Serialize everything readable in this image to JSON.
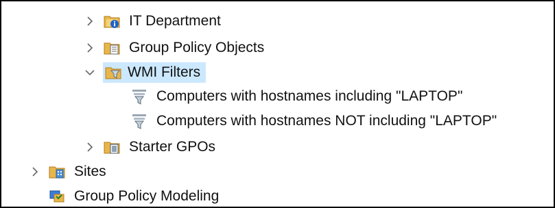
{
  "tree": {
    "items": [
      {
        "label": "IT Department",
        "icon": "ou-folder-info-icon",
        "expander": "collapsed"
      },
      {
        "label": "Group Policy Objects",
        "icon": "gpo-folder-icon",
        "expander": "collapsed"
      },
      {
        "label": "WMI Filters",
        "icon": "wmi-folder-icon",
        "expander": "expanded",
        "selected": true
      },
      {
        "label": "Computers with hostnames including \"LAPTOP\"",
        "icon": "wmi-filter-icon"
      },
      {
        "label": "Computers with hostnames NOT including \"LAPTOP\"",
        "icon": "wmi-filter-icon"
      },
      {
        "label": "Starter GPOs",
        "icon": "starter-gpo-folder-icon",
        "expander": "collapsed"
      },
      {
        "label": "Sites",
        "icon": "sites-icon",
        "expander": "collapsed"
      },
      {
        "label": "Group Policy Modeling",
        "icon": "gp-modeling-icon"
      }
    ]
  },
  "colors": {
    "selection": "#cce8ff",
    "folder": "#e8b64a",
    "chevron": "#666666"
  }
}
